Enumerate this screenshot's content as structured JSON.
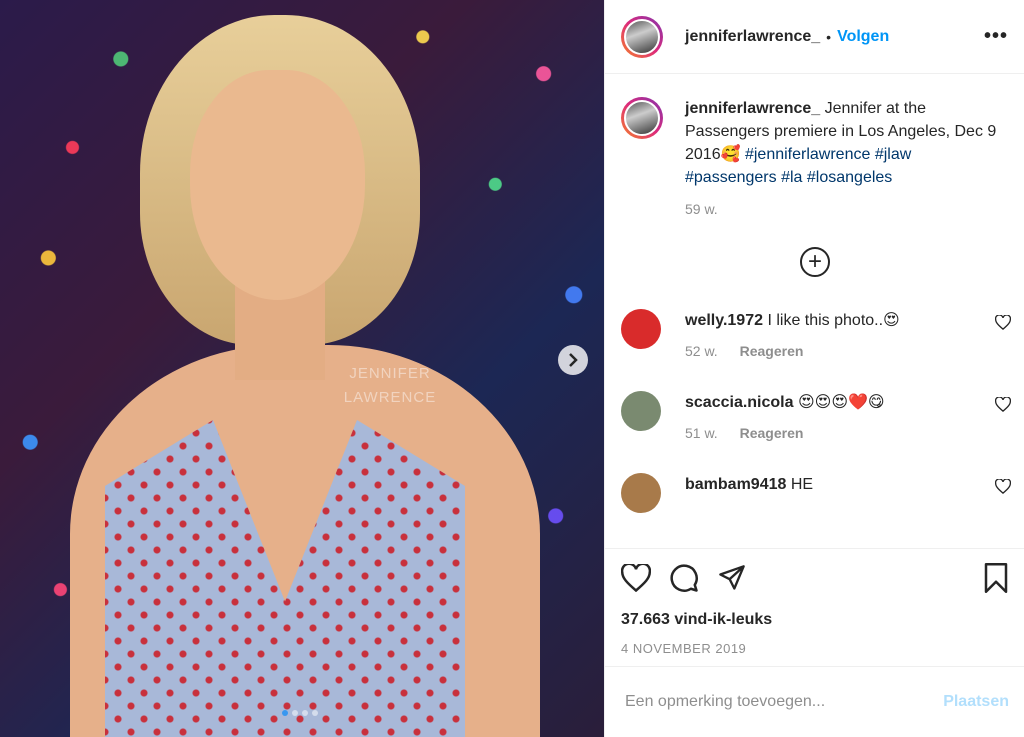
{
  "photo": {
    "watermark_line1": "JENNIFER",
    "watermark_line2": "LAWRENCE",
    "carousel_dots": 4,
    "carousel_active": 1
  },
  "header": {
    "username": "jenniferlawrence_",
    "separator": "•",
    "follow_label": "Volgen",
    "more_icon": "more-horizontal-icon"
  },
  "caption": {
    "username": "jenniferlawrence_",
    "text": "Jennifer at the Passengers premiere in Los Angeles, Dec 9 2016🥰",
    "hashtags": [
      "#jenniferlawrence",
      "#jlaw",
      "#passengers",
      "#la",
      "#losangeles"
    ],
    "time": "59 w."
  },
  "comments": [
    {
      "username": "welly.1972",
      "text": "I like this photo..😍",
      "time": "52 w.",
      "reply": "Reageren",
      "avatar_color": "#d92b2b"
    },
    {
      "username": "scaccia.nicola",
      "text": "😍😍😍❤️😋",
      "time": "51 w.",
      "reply": "Reageren",
      "avatar_color": "#7a8a70"
    },
    {
      "username": "bambam9418",
      "text": "HE",
      "time": "",
      "reply": "",
      "avatar_color": "#a87a4a"
    }
  ],
  "actions": {
    "likes": "37.663 vind-ik-leuks",
    "date": "4 NOVEMBER 2019"
  },
  "add_comment": {
    "placeholder": "Een opmerking toevoegen...",
    "post_label": "Plaatsen"
  }
}
